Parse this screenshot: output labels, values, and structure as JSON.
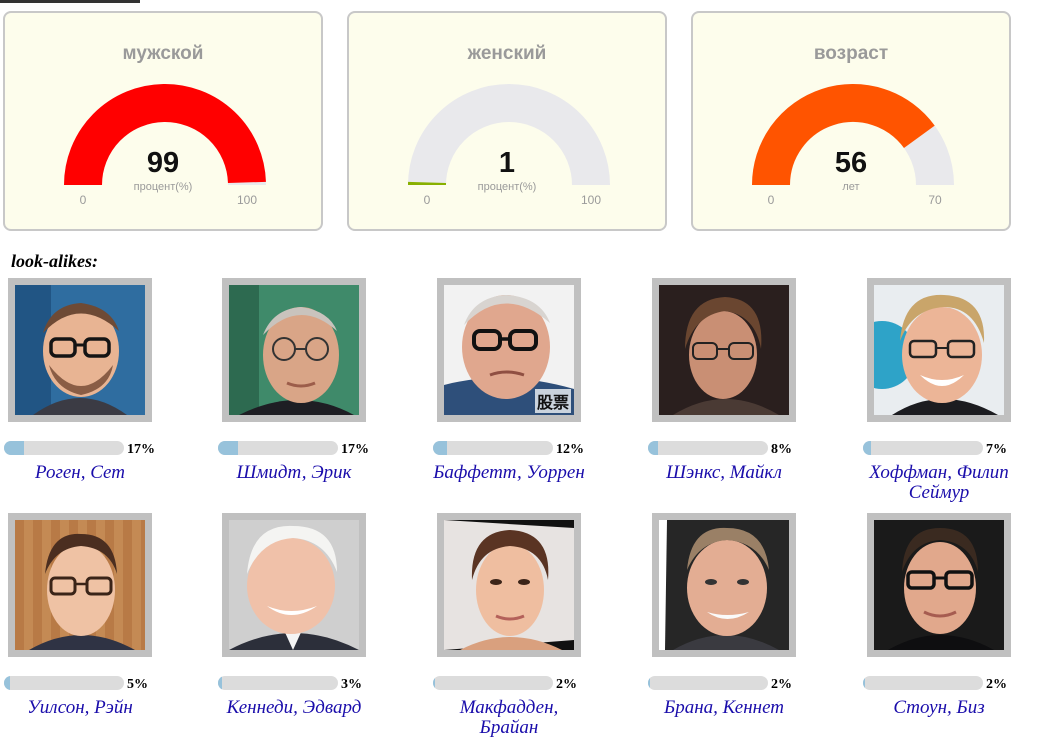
{
  "gauges": [
    {
      "title": "мужской",
      "value": "99",
      "unit": "процент(%)",
      "min": "0",
      "max": "100",
      "fraction": 0.99,
      "color": "#ff0000"
    },
    {
      "title": "женский",
      "value": "1",
      "unit": "процент(%)",
      "min": "0",
      "max": "100",
      "fraction": 0.01,
      "color": "#88b000"
    },
    {
      "title": "возраст",
      "value": "56",
      "unit": "лет",
      "min": "0",
      "max": "70",
      "fraction": 0.8,
      "color": "#ff5400"
    }
  ],
  "lookalikes": {
    "heading": "look-alikes:",
    "people": [
      {
        "name": "Роген, Сет",
        "percent": "17%",
        "value": 17
      },
      {
        "name": "Шмидт, Эрик",
        "percent": "17%",
        "value": 17
      },
      {
        "name": "Баффетт, Уоррен",
        "percent": "12%",
        "value": 12,
        "photo_caption": "股票"
      },
      {
        "name": "Шэнкс, Майкл",
        "percent": "8%",
        "value": 8
      },
      {
        "name": "Хоффман, Филип Сеймур",
        "percent": "7%",
        "value": 7
      },
      {
        "name": "Уилсон, Рэйн",
        "percent": "5%",
        "value": 5
      },
      {
        "name": "Кеннеди, Эдвард",
        "percent": "3%",
        "value": 3
      },
      {
        "name": "Макфадден, Брайан",
        "percent": "2%",
        "value": 2
      },
      {
        "name": "Брана, Кеннет",
        "percent": "2%",
        "value": 2
      },
      {
        "name": "Стоун, Биз",
        "percent": "2%",
        "value": 2
      }
    ]
  }
}
